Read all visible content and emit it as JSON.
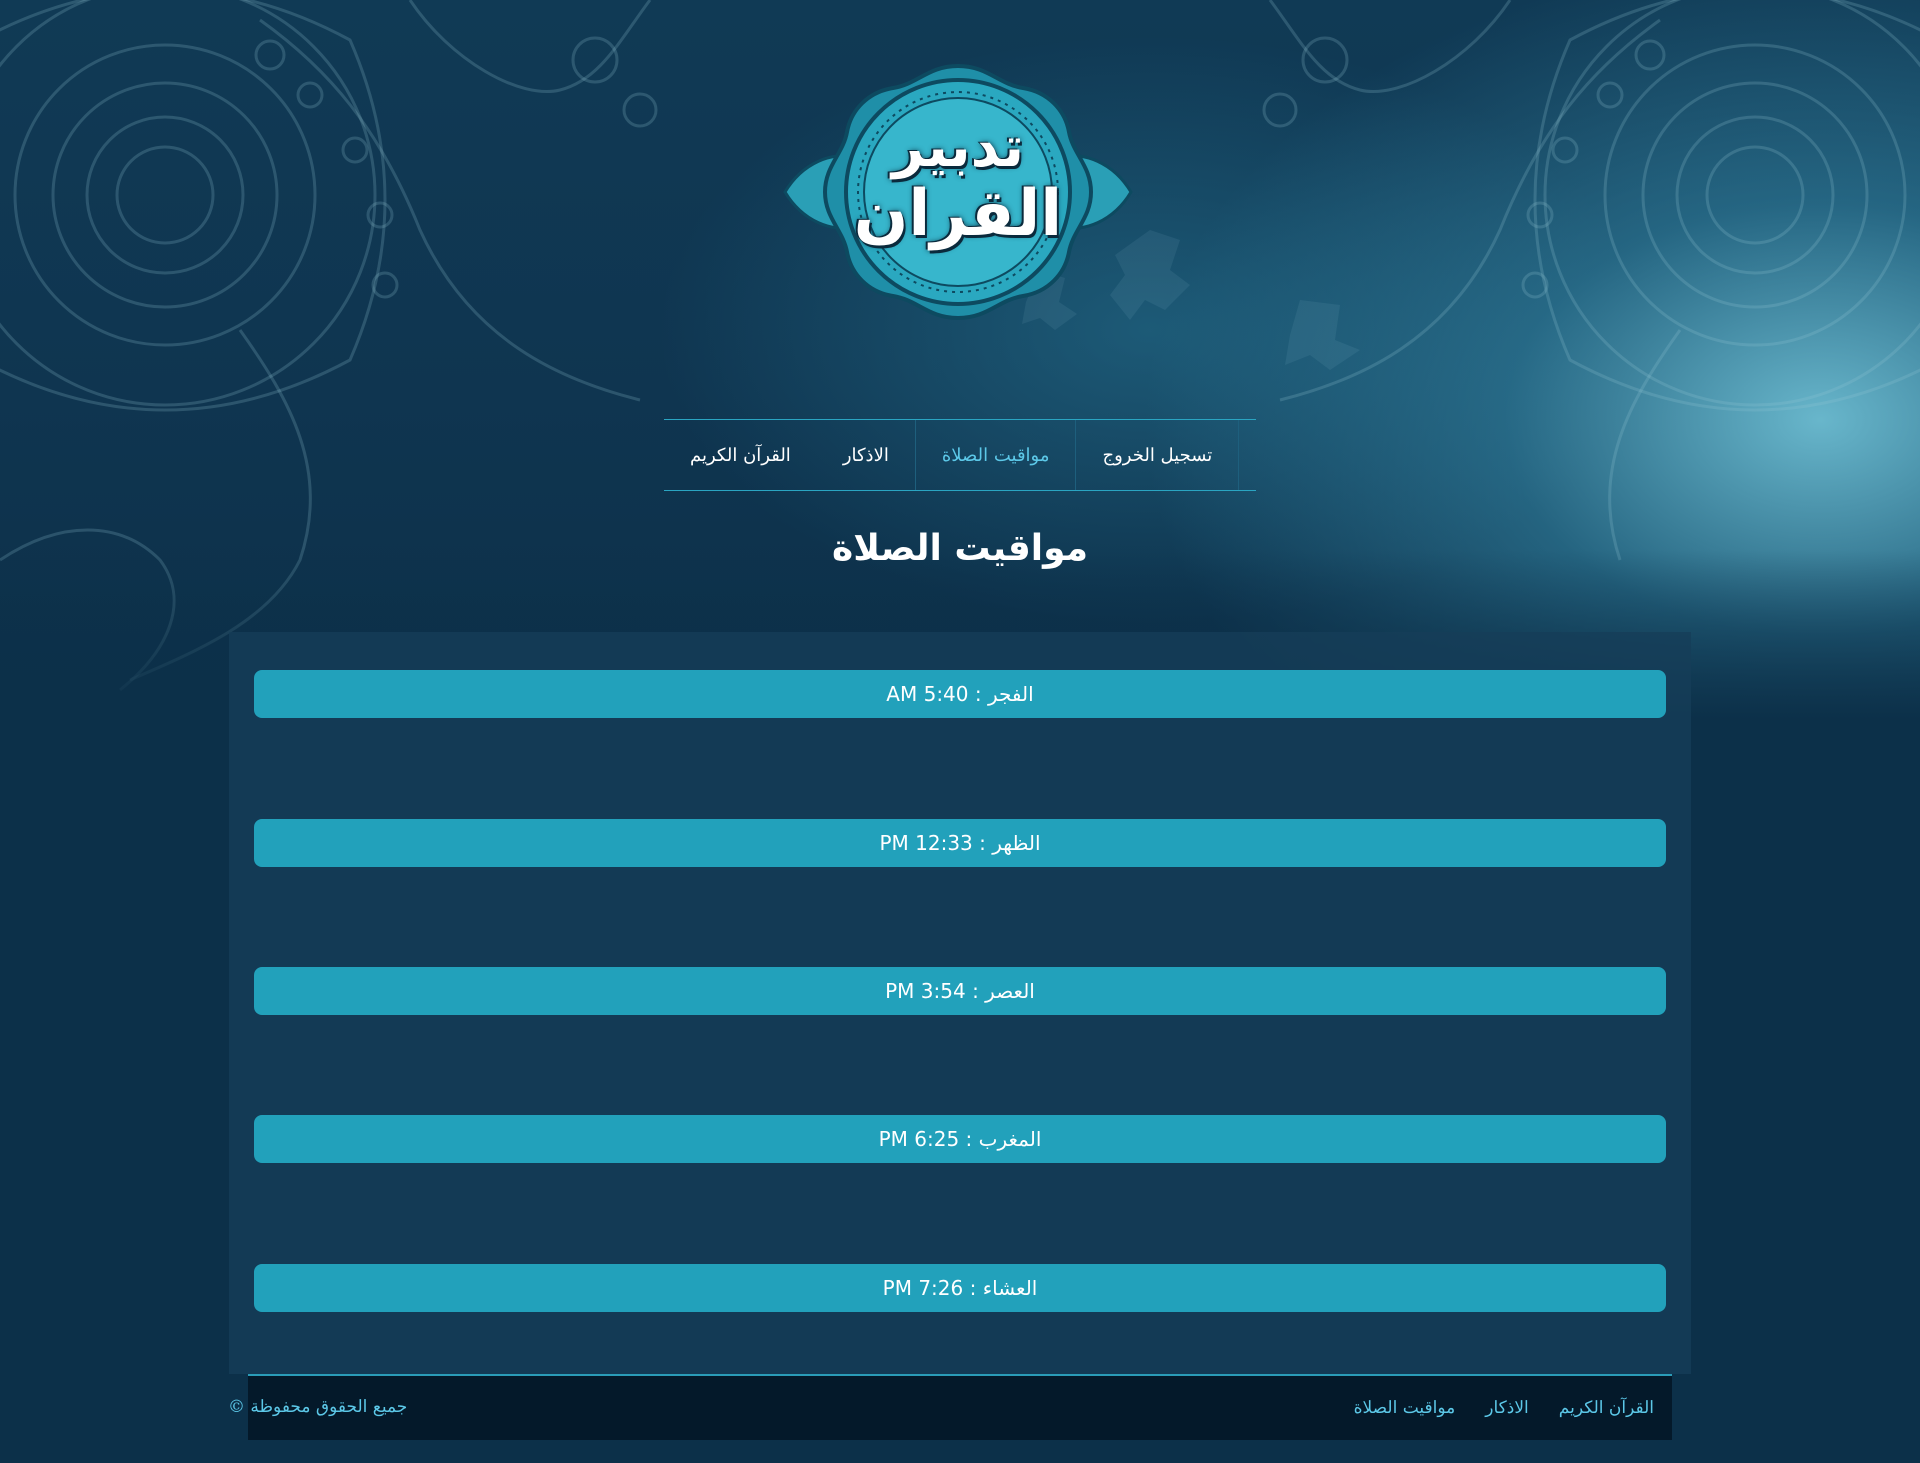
{
  "logo": {
    "line1": "تدبير",
    "line2": "القران"
  },
  "nav": {
    "items": [
      {
        "label": "القرآن الكريم",
        "active": false
      },
      {
        "label": "الاذكار",
        "active": false
      },
      {
        "label": "مواقيت الصلاة",
        "active": true
      },
      {
        "label": "تسجيل الخروج",
        "active": false
      }
    ]
  },
  "page": {
    "title": "مواقيت الصلاة"
  },
  "prayers": [
    {
      "name": "الفجر",
      "time": "AM 5:40"
    },
    {
      "name": "الظهر",
      "time": "PM 12:33"
    },
    {
      "name": "العصر",
      "time": "PM 3:54"
    },
    {
      "name": "المغرب",
      "time": "PM 6:25"
    },
    {
      "name": "العشاء",
      "time": "PM 7:26"
    }
  ],
  "footer": {
    "links": [
      "القرآن الكريم",
      "الاذكار",
      "مواقيت الصلاة"
    ],
    "copyright": "جميع الحقوق محفوظة ©"
  },
  "colors": {
    "page_background": "#0c3049",
    "accent": "#22a1bb",
    "link": "#5cc8e8",
    "footer_background": "#04192a"
  },
  "icons": {
    "decoration": "mandala-ornament",
    "logo": "islamic-badge-logo"
  }
}
